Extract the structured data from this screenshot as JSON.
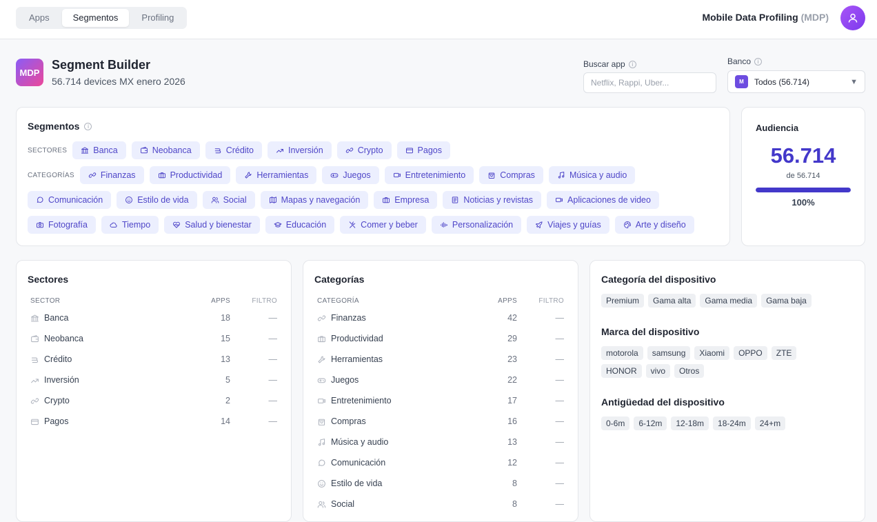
{
  "nav": {
    "tabs": [
      "Apps",
      "Segmentos",
      "Profiling"
    ],
    "active": "Segmentos"
  },
  "brand": {
    "name": "Mobile Data Profiling",
    "abbr": "(MDP)"
  },
  "header": {
    "logo": "MDP",
    "title": "Segment Builder",
    "subtitle": "56.714 devices MX enero 2026"
  },
  "search": {
    "label": "Buscar app",
    "placeholder": "Netflix, Rappi, Uber..."
  },
  "bank": {
    "label": "Banco",
    "badge": "M",
    "value": "Todos (56.714)"
  },
  "segments": {
    "title": "Segmentos",
    "sectors_label": "SECTORES",
    "categories_label": "CATEGORÍAS",
    "sectors": [
      {
        "label": "Banca",
        "icon": "bank-icon"
      },
      {
        "label": "Neobanca",
        "icon": "wallet-icon"
      },
      {
        "label": "Crédito",
        "icon": "credit-icon"
      },
      {
        "label": "Inversión",
        "icon": "trend-icon"
      },
      {
        "label": "Crypto",
        "icon": "link-icon"
      },
      {
        "label": "Pagos",
        "icon": "card-icon"
      }
    ],
    "categories": [
      {
        "label": "Finanzas",
        "icon": "link-icon"
      },
      {
        "label": "Productividad",
        "icon": "briefcase-icon"
      },
      {
        "label": "Herramientas",
        "icon": "wrench-icon"
      },
      {
        "label": "Juegos",
        "icon": "gamepad-icon"
      },
      {
        "label": "Entretenimiento",
        "icon": "video-icon"
      },
      {
        "label": "Compras",
        "icon": "bag-icon"
      },
      {
        "label": "Música y audio",
        "icon": "music-icon"
      },
      {
        "label": "Comunicación",
        "icon": "chat-icon"
      },
      {
        "label": "Estilo de vida",
        "icon": "smile-icon"
      },
      {
        "label": "Social",
        "icon": "users-icon"
      },
      {
        "label": "Mapas y navegación",
        "icon": "map-icon"
      },
      {
        "label": "Empresa",
        "icon": "briefcase-icon"
      },
      {
        "label": "Noticias y revistas",
        "icon": "news-icon"
      },
      {
        "label": "Aplicaciones de video",
        "icon": "video-icon"
      },
      {
        "label": "Fotografía",
        "icon": "camera-icon"
      },
      {
        "label": "Tiempo",
        "icon": "cloud-icon"
      },
      {
        "label": "Salud y bienestar",
        "icon": "heart-icon"
      },
      {
        "label": "Educación",
        "icon": "cap-icon"
      },
      {
        "label": "Comer y beber",
        "icon": "utensils-icon"
      },
      {
        "label": "Personalización",
        "icon": "wave-icon"
      },
      {
        "label": "Viajes y guías",
        "icon": "plane-icon"
      },
      {
        "label": "Arte y diseño",
        "icon": "palette-icon"
      }
    ]
  },
  "audience": {
    "title": "Audiencia",
    "value": "56.714",
    "of": "de 56.714",
    "percent": "100%",
    "fill": 1.0
  },
  "sectors_table": {
    "title": "Sectores",
    "headers": [
      "SECTOR",
      "APPS",
      "FILTRO"
    ],
    "rows": [
      {
        "name": "Banca",
        "apps": "18",
        "filter": "—",
        "icon": "bank-icon"
      },
      {
        "name": "Neobanca",
        "apps": "15",
        "filter": "—",
        "icon": "wallet-icon"
      },
      {
        "name": "Crédito",
        "apps": "13",
        "filter": "—",
        "icon": "credit-icon"
      },
      {
        "name": "Inversión",
        "apps": "5",
        "filter": "—",
        "icon": "trend-icon"
      },
      {
        "name": "Crypto",
        "apps": "2",
        "filter": "—",
        "icon": "link-icon"
      },
      {
        "name": "Pagos",
        "apps": "14",
        "filter": "—",
        "icon": "card-icon"
      }
    ]
  },
  "categories_table": {
    "title": "Categorías",
    "headers": [
      "CATEGORÍA",
      "APPS",
      "FILTRO"
    ],
    "rows": [
      {
        "name": "Finanzas",
        "apps": "42",
        "filter": "—",
        "icon": "link-icon"
      },
      {
        "name": "Productividad",
        "apps": "29",
        "filter": "—",
        "icon": "briefcase-icon"
      },
      {
        "name": "Herramientas",
        "apps": "23",
        "filter": "—",
        "icon": "wrench-icon"
      },
      {
        "name": "Juegos",
        "apps": "22",
        "filter": "—",
        "icon": "gamepad-icon"
      },
      {
        "name": "Entretenimiento",
        "apps": "17",
        "filter": "—",
        "icon": "video-icon"
      },
      {
        "name": "Compras",
        "apps": "16",
        "filter": "—",
        "icon": "bag-icon"
      },
      {
        "name": "Música y audio",
        "apps": "13",
        "filter": "—",
        "icon": "music-icon"
      },
      {
        "name": "Comunicación",
        "apps": "12",
        "filter": "—",
        "icon": "chat-icon"
      },
      {
        "name": "Estilo de vida",
        "apps": "8",
        "filter": "—",
        "icon": "smile-icon"
      },
      {
        "name": "Social",
        "apps": "8",
        "filter": "—",
        "icon": "users-icon"
      }
    ]
  },
  "device": {
    "category_title": "Categoría del dispositivo",
    "categories": [
      "Premium",
      "Gama alta",
      "Gama media",
      "Gama baja"
    ],
    "brand_title": "Marca del dispositivo",
    "brands": [
      "motorola",
      "samsung",
      "Xiaomi",
      "OPPO",
      "ZTE",
      "HONOR",
      "vivo",
      "Otros"
    ],
    "age_title": "Antigüedad del dispositivo",
    "ages": [
      "0-6m",
      "6-12m",
      "12-18m",
      "18-24m",
      "24+m"
    ]
  }
}
